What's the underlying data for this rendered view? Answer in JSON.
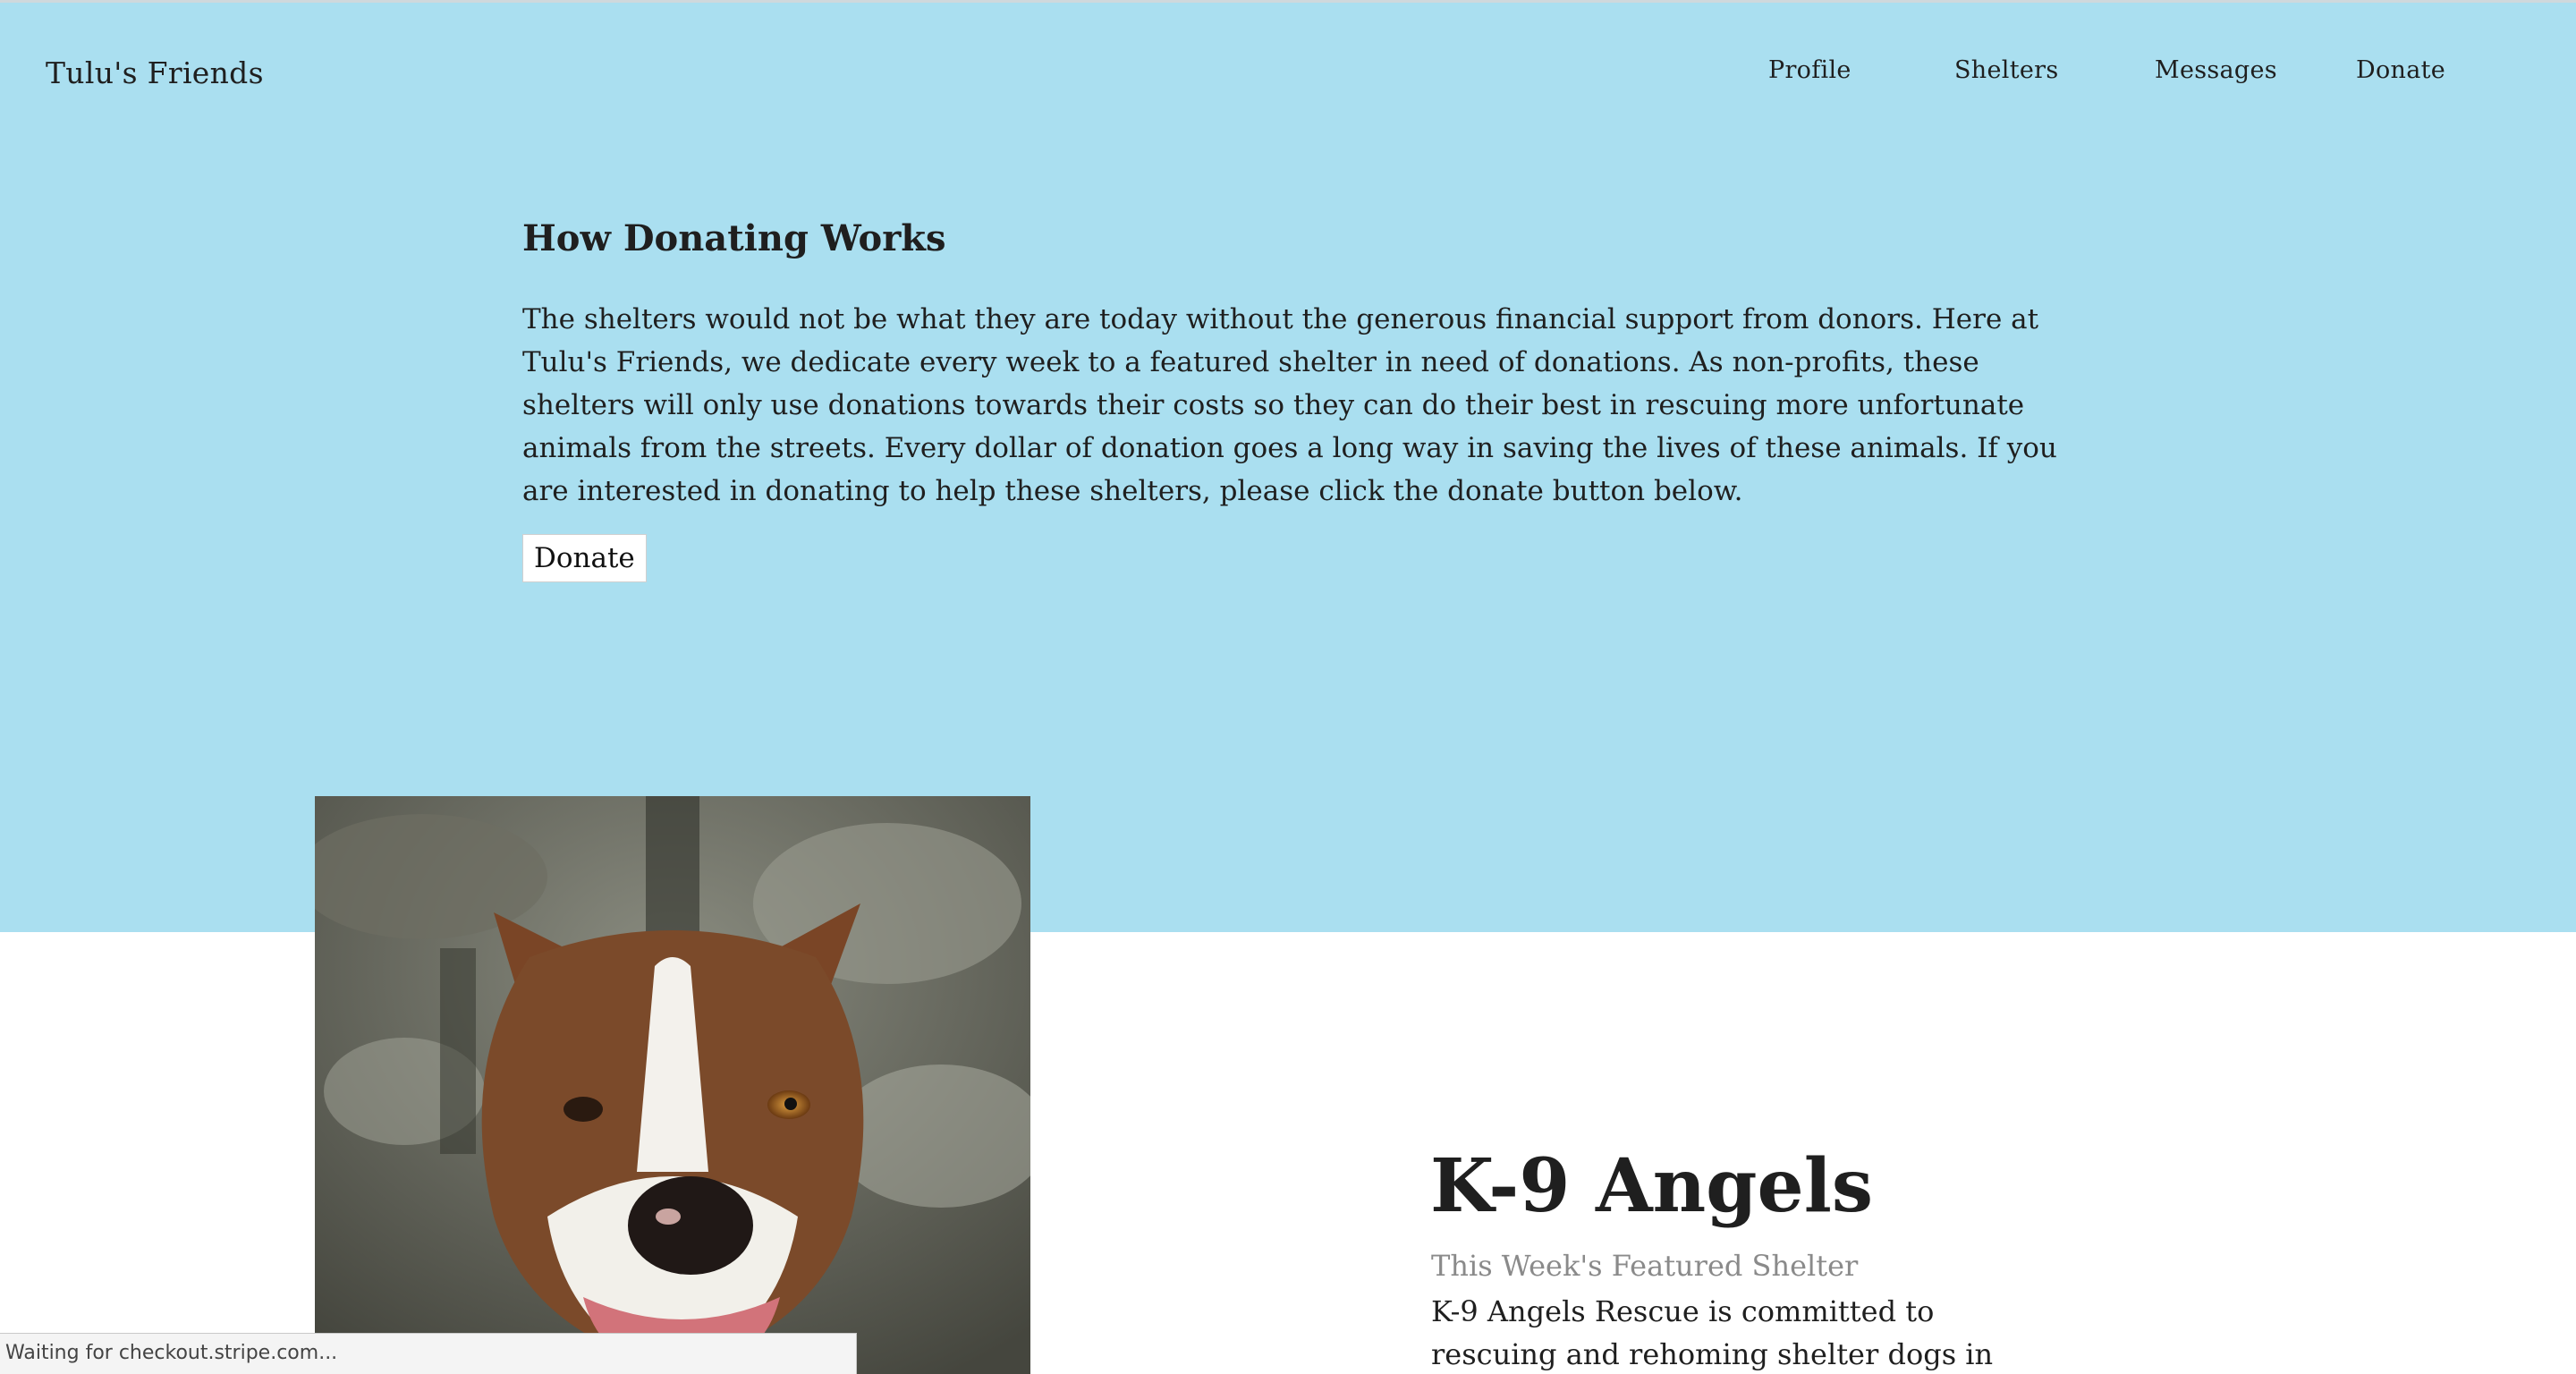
{
  "brand": "Tulu's Friends",
  "nav": {
    "profile": "Profile",
    "shelters": "Shelters",
    "messages": "Messages",
    "donate": "Donate"
  },
  "how": {
    "title": "How Donating Works",
    "body": "The shelters would not be what they are today without the generous financial support from donors. Here at Tulu's Friends, we dedicate every week to a featured shelter in need of donations. As non-profits, these shelters will only use donations towards their costs so they can do their best in rescuing more unfortunate animals from the streets. Every dollar of donation goes a long way in saving the lives of these animals. If you are interested in donating to help these shelters, please click the donate button below.",
    "button_label": "Donate"
  },
  "featured": {
    "name": "K-9 Angels",
    "subtitle": "This Week's Featured Shelter",
    "description": "K-9 Angels Rescue is committed to rescuing and rehoming shelter dogs in"
  },
  "status_text": "Waiting for checkout.stripe.com...",
  "colors": {
    "hero_background": "#aadff0",
    "page_background": "#ffffff",
    "text": "#1f1f1f",
    "subtitle": "#8a8a8a"
  }
}
